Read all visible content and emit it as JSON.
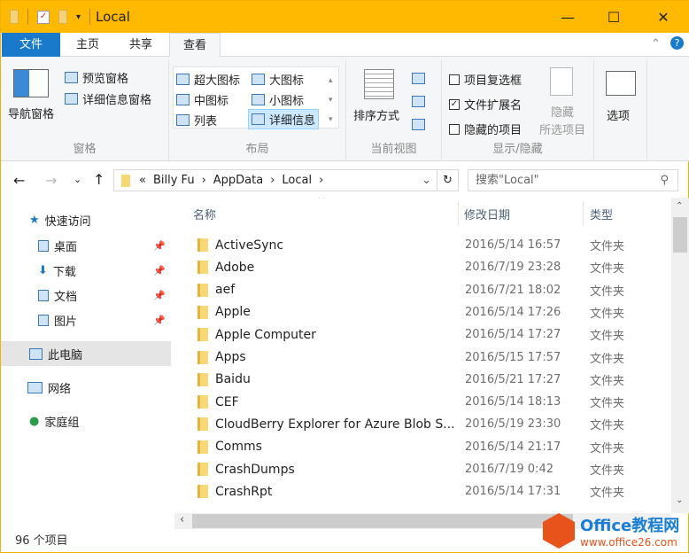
{
  "title": "Local",
  "tabs": [
    "文件",
    "主页",
    "共享",
    "查看"
  ],
  "ribbon": {
    "pane": {
      "nav": "导航窗格",
      "preview": "预览窗格",
      "details": "详细信息窗格",
      "label": "窗格"
    },
    "layout": {
      "xl": "超大图标",
      "l": "大图标",
      "m": "中图标",
      "s": "小图标",
      "list": "列表",
      "detail": "详细信息",
      "label": "布局"
    },
    "view": {
      "sort": "排序方式",
      "label": "当前视图"
    },
    "show": {
      "checkboxes": "项目复选框",
      "ext": "文件扩展名",
      "hidden": "隐藏的项目",
      "hide1": "隐藏",
      "hide2": "所选项目",
      "label": "显示/隐藏"
    },
    "options": "选项"
  },
  "address": {
    "prefix": "«",
    "path": [
      "Billy Fu",
      "AppData",
      "Local"
    ],
    "search_placeholder": "搜索\"Local\""
  },
  "nav": [
    {
      "label": "快速访问"
    },
    {
      "label": "桌面"
    },
    {
      "label": "下载"
    },
    {
      "label": "文档"
    },
    {
      "label": "图片"
    },
    {
      "label": "此电脑"
    },
    {
      "label": "网络"
    },
    {
      "label": "家庭组"
    }
  ],
  "columns": {
    "name": "名称",
    "date": "修改日期",
    "type": "类型"
  },
  "files": [
    {
      "name": "ActiveSync",
      "date": "2016/5/14 16:57",
      "type": "文件夹"
    },
    {
      "name": "Adobe",
      "date": "2016/7/19 23:28",
      "type": "文件夹"
    },
    {
      "name": "aef",
      "date": "2016/7/21 18:02",
      "type": "文件夹"
    },
    {
      "name": "Apple",
      "date": "2016/5/14 17:26",
      "type": "文件夹"
    },
    {
      "name": "Apple Computer",
      "date": "2016/5/14 17:27",
      "type": "文件夹"
    },
    {
      "name": "Apps",
      "date": "2016/5/15 17:57",
      "type": "文件夹"
    },
    {
      "name": "Baidu",
      "date": "2016/5/21 17:27",
      "type": "文件夹"
    },
    {
      "name": "CEF",
      "date": "2016/5/14 18:13",
      "type": "文件夹"
    },
    {
      "name": "CloudBerry Explorer for Azure Blob S...",
      "date": "2016/5/19 23:30",
      "type": "文件夹"
    },
    {
      "name": "Comms",
      "date": "2016/5/14 21:17",
      "type": "文件夹"
    },
    {
      "name": "CrashDumps",
      "date": "2016/7/19 0:42",
      "type": "文件夹"
    },
    {
      "name": "CrashRpt",
      "date": "2016/5/14 17:31",
      "type": "文件夹"
    }
  ],
  "status": "96 个项目",
  "watermark": {
    "t1": "Office教程网",
    "t2": "www.office26.com"
  }
}
